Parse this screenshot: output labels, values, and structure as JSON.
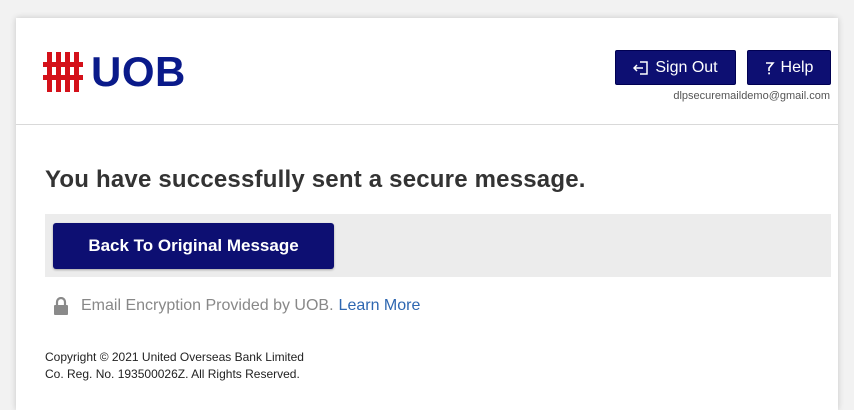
{
  "header": {
    "logo_text": "UOB",
    "sign_out_label": "Sign Out",
    "help_label": "Help",
    "user_email": "dlpsecuremaildemo@gmail.com"
  },
  "main": {
    "title": "You have successfully sent a secure message.",
    "back_button_label": "Back To Original Message",
    "encryption_text": "Email Encryption Provided by UOB.",
    "learn_more_label": "Learn More"
  },
  "footer": {
    "copyright_line1": "Copyright © 2021 United Overseas Bank Limited",
    "copyright_line2": "Co. Reg. No. 193500026Z. All Rights Reserved."
  },
  "colors": {
    "brand_blue": "#0d0f72",
    "logo_red": "#d4111a",
    "logo_blue": "#0a1a8a",
    "link_blue": "#2e67b1"
  }
}
